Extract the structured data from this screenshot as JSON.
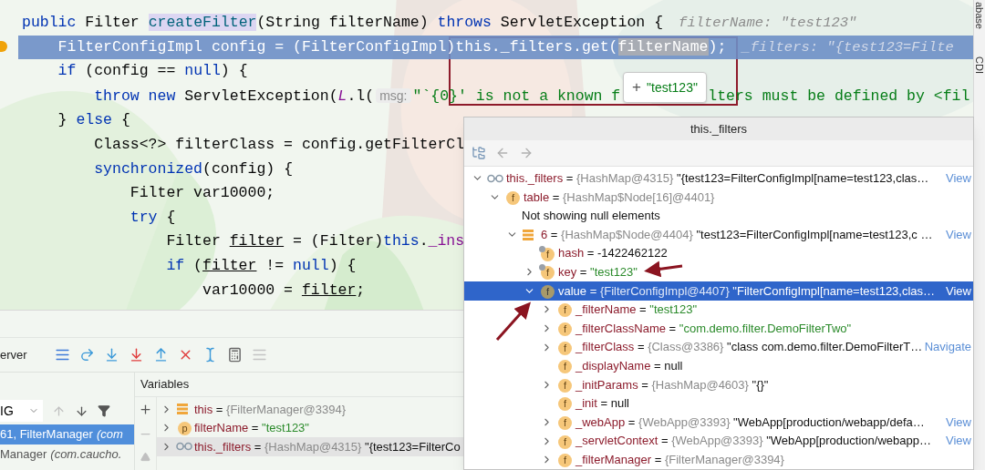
{
  "editor": {
    "lines": [
      {
        "current": false,
        "segments": [
          {
            "text": "public",
            "kind": "kw"
          },
          {
            "text": " Filter ",
            "kind": "plain"
          },
          {
            "text": "createFilter",
            "kind": "decl"
          },
          {
            "text": "(String filterName) ",
            "kind": "plain"
          },
          {
            "text": "throws",
            "kind": "kw"
          },
          {
            "text": " ServletException {",
            "kind": "plain"
          }
        ],
        "hint": "filterName: \"test123\"",
        "children": [
          {
            "current": true,
            "segments": [
              {
                "text": "FilterConfigImpl config = (FilterConfigImpl)this._filters.get(",
                "kind": "plain"
              },
              {
                "text": "filterName",
                "kind": "match"
              },
              {
                "text": ");",
                "kind": "plain"
              }
            ],
            "hint": "_filters: \"{test123=Filte"
          },
          {
            "current": false,
            "segments": [
              {
                "text": "if",
                "kind": "kw"
              },
              {
                "text": " (config == ",
                "kind": "plain"
              },
              {
                "text": "null",
                "kind": "kw"
              },
              {
                "text": ") {",
                "kind": "plain"
              }
            ],
            "children": [
              {
                "current": false,
                "segments": [
                  {
                    "text": "throw new",
                    "kind": "kw"
                  },
                  {
                    "text": " ServletException(",
                    "kind": "plain"
                  },
                  {
                    "text": "L",
                    "kind": "static"
                  },
                  {
                    "text": ".l(",
                    "kind": "plain"
                  },
                  {
                    "text": "msg:",
                    "kind": "chip"
                  },
                  {
                    "text": "\"`{0}' is not a known f",
                    "kind": "str"
                  },
                  {
                    "kind": "gap"
                  },
                  {
                    "text": "lters must be defined by <fil",
                    "kind": "str"
                  }
                ]
              }
            ]
          },
          {
            "current": false,
            "segments": [
              {
                "text": "} ",
                "kind": "plain"
              },
              {
                "text": "else",
                "kind": "kw"
              },
              {
                "text": " {",
                "kind": "plain"
              }
            ],
            "children": [
              {
                "current": false,
                "segments": [
                  {
                    "text": "Class<?> filterClass = config.getFilterCl",
                    "kind": "plain"
                  }
                ]
              },
              {
                "current": false,
                "segments": [
                  {
                    "text": "synchronized",
                    "kind": "kw"
                  },
                  {
                    "text": "(config) {",
                    "kind": "plain"
                  }
                ],
                "children": [
                  {
                    "current": false,
                    "segments": [
                      {
                        "text": "Filter var10000;",
                        "kind": "plain"
                      }
                    ]
                  },
                  {
                    "current": false,
                    "segments": [
                      {
                        "text": "try",
                        "kind": "kw"
                      },
                      {
                        "text": " {",
                        "kind": "plain"
                      }
                    ],
                    "children": [
                      {
                        "current": false,
                        "segments": [
                          {
                            "text": "Filter ",
                            "kind": "plain"
                          },
                          {
                            "text": "filter",
                            "kind": "var"
                          },
                          {
                            "text": " = (Filter)",
                            "kind": "plain"
                          },
                          {
                            "text": "this",
                            "kind": "kw"
                          },
                          {
                            "text": ".",
                            "kind": "plain"
                          },
                          {
                            "text": "_ins",
                            "kind": "field"
                          }
                        ]
                      },
                      {
                        "current": false,
                        "segments": [
                          {
                            "text": "if",
                            "kind": "kw"
                          },
                          {
                            "text": " (",
                            "kind": "plain"
                          },
                          {
                            "text": "filter",
                            "kind": "var"
                          },
                          {
                            "text": " != ",
                            "kind": "plain"
                          },
                          {
                            "text": "null",
                            "kind": "kw"
                          },
                          {
                            "text": ") {",
                            "kind": "plain"
                          }
                        ],
                        "children": [
                          {
                            "current": false,
                            "segments": [
                              {
                                "text": "var10000 = ",
                                "kind": "plain"
                              },
                              {
                                "text": "filter",
                                "kind": "var"
                              },
                              {
                                "text": ";",
                                "kind": "plain"
                              }
                            ]
                          }
                        ]
                      }
                    ]
                  }
                ]
              }
            ]
          }
        ]
      }
    ],
    "value_tooltip": {
      "sign": "+",
      "value": "\"test123\""
    }
  },
  "side_tabs": [
    "abase",
    "CDI"
  ],
  "debugger": {
    "tab": "erver",
    "variables_title": "Variables",
    "thread": "IG",
    "frames": [
      {
        "text": "61, FilterManager",
        "detail": "(com",
        "selected": true
      },
      {
        "text": "Manager",
        "detail": "(com.caucho.",
        "selected": false
      }
    ],
    "variables": [
      {
        "kind": "array",
        "selected": false,
        "segments": [
          {
            "text": "this",
            "kind": "name"
          },
          {
            "text": " = ",
            "kind": "plain"
          },
          {
            "text": "{FilterManager@3394}",
            "kind": "type"
          }
        ]
      },
      {
        "kind": "param",
        "badge": "p",
        "selected": false,
        "segments": [
          {
            "text": "filterName",
            "kind": "name"
          },
          {
            "text": " = ",
            "kind": "plain"
          },
          {
            "text": "\"test123\"",
            "kind": "str"
          }
        ]
      },
      {
        "kind": "watch",
        "selected": true,
        "segments": [
          {
            "text": "this._filters",
            "kind": "name"
          },
          {
            "text": " = ",
            "kind": "plain"
          },
          {
            "text": "{HashMap@4315}",
            "kind": "type"
          },
          {
            "text": " \"{test123=FilterCo",
            "kind": "plain"
          }
        ]
      }
    ]
  },
  "popup": {
    "title": "this._filters",
    "tree": [
      {
        "kind": "watch",
        "expandable": true,
        "expanded": true,
        "selected": false,
        "segments": [
          {
            "text": "this._filters",
            "kind": "name"
          },
          {
            "text": " = ",
            "kind": "plain"
          },
          {
            "text": "{HashMap@4315}",
            "kind": "type"
          },
          {
            "text": " \"{test123=FilterConfigImpl[name=test123,clas…",
            "kind": "plain"
          }
        ],
        "link": "View",
        "children": [
          {
            "kind": "field",
            "badge": "f",
            "pinned": false,
            "expandable": true,
            "expanded": true,
            "selected": false,
            "segments": [
              {
                "text": "table",
                "kind": "name"
              },
              {
                "text": " = ",
                "kind": "plain"
              },
              {
                "text": "{HashMap$Node[16]@4401}",
                "kind": "type"
              }
            ],
            "children": [
              {
                "kind": "note",
                "expandable": false,
                "selected": false,
                "segments": [
                  {
                    "text": "Not showing null elements",
                    "kind": "plain"
                  }
                ]
              },
              {
                "kind": "array",
                "expandable": true,
                "expanded": true,
                "selected": false,
                "segments": [
                  {
                    "text": "6",
                    "kind": "name"
                  },
                  {
                    "text": " = ",
                    "kind": "plain"
                  },
                  {
                    "text": "{HashMap$Node@4404}",
                    "kind": "type"
                  },
                  {
                    "text": " \"test123=FilterConfigImpl[name=test123,c …",
                    "kind": "plain"
                  }
                ],
                "link": "View",
                "children": [
                  {
                    "kind": "field",
                    "badge": "f",
                    "pinned": true,
                    "expandable": false,
                    "selected": false,
                    "segments": [
                      {
                        "text": "hash",
                        "kind": "name"
                      },
                      {
                        "text": " = -1422462122",
                        "kind": "plain"
                      }
                    ]
                  },
                  {
                    "kind": "field",
                    "badge": "f",
                    "pinned": true,
                    "expandable": true,
                    "expanded": false,
                    "selected": false,
                    "segments": [
                      {
                        "text": "key",
                        "kind": "name"
                      },
                      {
                        "text": " = ",
                        "kind": "plain"
                      },
                      {
                        "text": "\"test123\"",
                        "kind": "str"
                      }
                    ]
                  },
                  {
                    "kind": "field",
                    "badge": "f",
                    "pinned": false,
                    "expandable": true,
                    "expanded": true,
                    "selected": true,
                    "segments": [
                      {
                        "text": "value",
                        "kind": "name"
                      },
                      {
                        "text": " = ",
                        "kind": "plain"
                      },
                      {
                        "text": "{FilterConfigImpl@4407}",
                        "kind": "type"
                      },
                      {
                        "text": " \"FilterConfigImpl[name=test123,clas…",
                        "kind": "plain"
                      }
                    ],
                    "link": "View",
                    "children": [
                      {
                        "kind": "field",
                        "badge": "f",
                        "pinned": false,
                        "expandable": true,
                        "expanded": false,
                        "selected": false,
                        "segments": [
                          {
                            "text": "_filterName",
                            "kind": "name"
                          },
                          {
                            "text": " = ",
                            "kind": "plain"
                          },
                          {
                            "text": "\"test123\"",
                            "kind": "str"
                          }
                        ]
                      },
                      {
                        "kind": "field",
                        "badge": "f",
                        "pinned": false,
                        "expandable": true,
                        "expanded": false,
                        "selected": false,
                        "segments": [
                          {
                            "text": "_filterClassName",
                            "kind": "name"
                          },
                          {
                            "text": " = ",
                            "kind": "plain"
                          },
                          {
                            "text": "\"com.demo.filter.DemoFilterTwo\"",
                            "kind": "str"
                          }
                        ]
                      },
                      {
                        "kind": "field",
                        "badge": "f",
                        "pinned": false,
                        "expandable": true,
                        "expanded": false,
                        "selected": false,
                        "segments": [
                          {
                            "text": "_filterClass",
                            "kind": "name"
                          },
                          {
                            "text": " = ",
                            "kind": "plain"
                          },
                          {
                            "text": "{Class@3386}",
                            "kind": "type"
                          },
                          {
                            "text": " \"class com.demo.filter.DemoFilterT…",
                            "kind": "plain"
                          }
                        ],
                        "link": "Navigate"
                      },
                      {
                        "kind": "field",
                        "badge": "f",
                        "pinned": false,
                        "expandable": false,
                        "selected": false,
                        "segments": [
                          {
                            "text": "_displayName",
                            "kind": "name"
                          },
                          {
                            "text": " = null",
                            "kind": "plain"
                          }
                        ]
                      },
                      {
                        "kind": "field",
                        "badge": "f",
                        "pinned": false,
                        "expandable": true,
                        "expanded": false,
                        "selected": false,
                        "segments": [
                          {
                            "text": "_initParams",
                            "kind": "name"
                          },
                          {
                            "text": " = ",
                            "kind": "plain"
                          },
                          {
                            "text": "{HashMap@4603}",
                            "kind": "type"
                          },
                          {
                            "text": " \"{}\"",
                            "kind": "plain"
                          }
                        ]
                      },
                      {
                        "kind": "field",
                        "badge": "f",
                        "pinned": false,
                        "expandable": false,
                        "selected": false,
                        "segments": [
                          {
                            "text": "_init",
                            "kind": "name"
                          },
                          {
                            "text": " = null",
                            "kind": "plain"
                          }
                        ]
                      },
                      {
                        "kind": "field",
                        "badge": "f",
                        "pinned": false,
                        "expandable": true,
                        "expanded": false,
                        "selected": false,
                        "segments": [
                          {
                            "text": "_webApp",
                            "kind": "name"
                          },
                          {
                            "text": " = ",
                            "kind": "plain"
                          },
                          {
                            "text": "{WebApp@3393}",
                            "kind": "type"
                          },
                          {
                            "text": " \"WebApp[production/webapp/defa…",
                            "kind": "plain"
                          }
                        ],
                        "link": "View"
                      },
                      {
                        "kind": "field",
                        "badge": "f",
                        "pinned": false,
                        "expandable": true,
                        "expanded": false,
                        "selected": false,
                        "segments": [
                          {
                            "text": "_servletContext",
                            "kind": "name"
                          },
                          {
                            "text": " = ",
                            "kind": "plain"
                          },
                          {
                            "text": "{WebApp@3393}",
                            "kind": "type"
                          },
                          {
                            "text": " \"WebApp[production/webapp…",
                            "kind": "plain"
                          }
                        ],
                        "link": "View"
                      },
                      {
                        "kind": "field",
                        "badge": "f",
                        "pinned": false,
                        "expandable": true,
                        "expanded": false,
                        "selected": false,
                        "segments": [
                          {
                            "text": "_filterManager",
                            "kind": "name"
                          },
                          {
                            "text": " = ",
                            "kind": "plain"
                          },
                          {
                            "text": "{FilterManager@3394}",
                            "kind": "type"
                          }
                        ]
                      }
                    ]
                  }
                ]
              }
            ]
          }
        ]
      }
    ]
  }
}
